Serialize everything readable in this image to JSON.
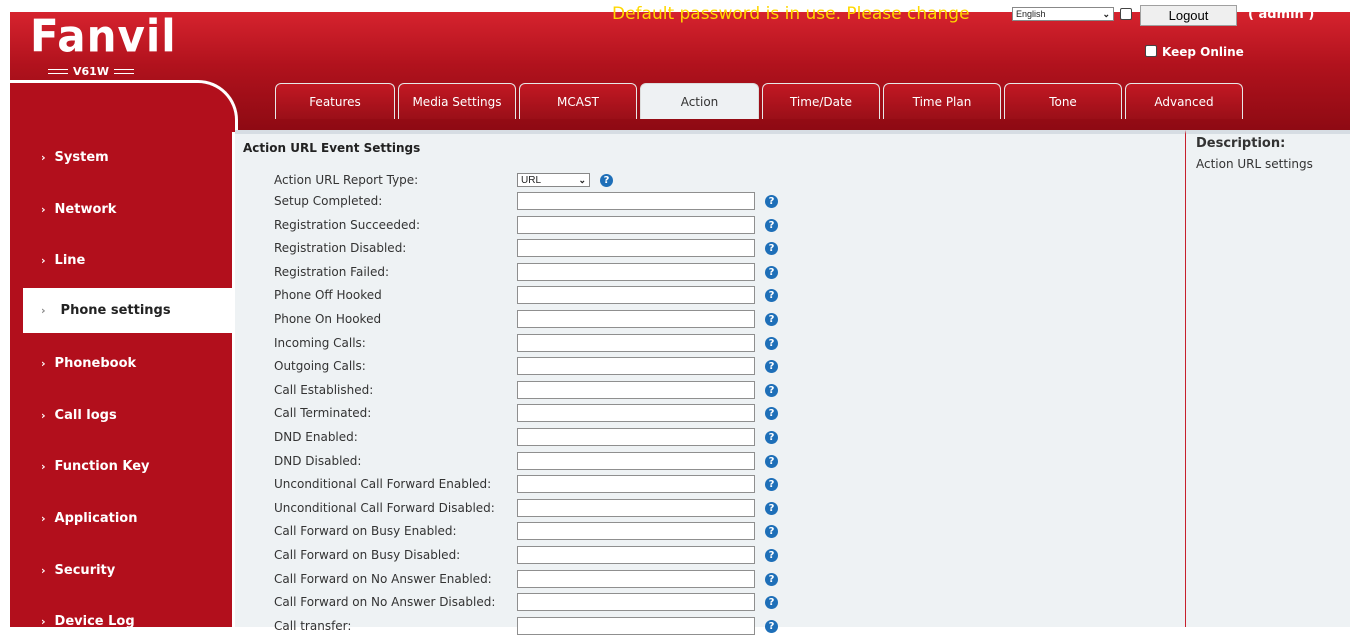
{
  "header": {
    "logo": "Fanvil",
    "model": "V61W",
    "banner": "Default password is in use. Please change",
    "language": "English",
    "logout_label": "Logout",
    "user_label": "( admin )",
    "keep_online_label": "Keep Online"
  },
  "tabs": [
    {
      "label": "Features",
      "active": false
    },
    {
      "label": "Media Settings",
      "active": false
    },
    {
      "label": "MCAST",
      "active": false
    },
    {
      "label": "Action",
      "active": true
    },
    {
      "label": "Time/Date",
      "active": false
    },
    {
      "label": "Time Plan",
      "active": false
    },
    {
      "label": "Tone",
      "active": false
    },
    {
      "label": "Advanced",
      "active": false
    }
  ],
  "sidebar": {
    "items": [
      {
        "label": "System"
      },
      {
        "label": "Network"
      },
      {
        "label": "Line"
      },
      {
        "label": "Phone settings",
        "active": true
      },
      {
        "label": "Phonebook"
      },
      {
        "label": "Call logs"
      },
      {
        "label": "Function Key"
      },
      {
        "label": "Application"
      },
      {
        "label": "Security"
      },
      {
        "label": "Device Log"
      }
    ]
  },
  "main": {
    "section_title": "Action URL Event Settings",
    "report_type_label": "Action URL Report Type:",
    "report_type_value": "URL",
    "fields": [
      {
        "label": "Setup Completed:",
        "value": ""
      },
      {
        "label": "Registration Succeeded:",
        "value": ""
      },
      {
        "label": "Registration Disabled:",
        "value": ""
      },
      {
        "label": "Registration Failed:",
        "value": ""
      },
      {
        "label": "Phone Off Hooked",
        "value": ""
      },
      {
        "label": "Phone On Hooked",
        "value": ""
      },
      {
        "label": "Incoming Calls:",
        "value": ""
      },
      {
        "label": "Outgoing Calls:",
        "value": ""
      },
      {
        "label": "Call Established:",
        "value": ""
      },
      {
        "label": "Call Terminated:",
        "value": ""
      },
      {
        "label": "DND Enabled:",
        "value": ""
      },
      {
        "label": "DND Disabled:",
        "value": ""
      },
      {
        "label": "Unconditional Call Forward Enabled:",
        "value": ""
      },
      {
        "label": "Unconditional Call Forward Disabled:",
        "value": ""
      },
      {
        "label": "Call Forward on Busy Enabled:",
        "value": ""
      },
      {
        "label": "Call Forward on Busy Disabled:",
        "value": ""
      },
      {
        "label": "Call Forward on No Answer Enabled:",
        "value": ""
      },
      {
        "label": "Call Forward on No Answer Disabled:",
        "value": ""
      },
      {
        "label": "Call transfer:",
        "value": ""
      }
    ]
  },
  "description": {
    "title": "Description:",
    "text": "Action URL settings"
  },
  "icons": {
    "help": "question-icon",
    "nav": "chevron-right-icon",
    "select": "chevron-down-icon"
  },
  "colors": {
    "brand_red": "#b20f1c",
    "banner_yellow": "#ffd800",
    "help_blue": "#1e6fb8",
    "content_bg": "#eef2f4"
  }
}
